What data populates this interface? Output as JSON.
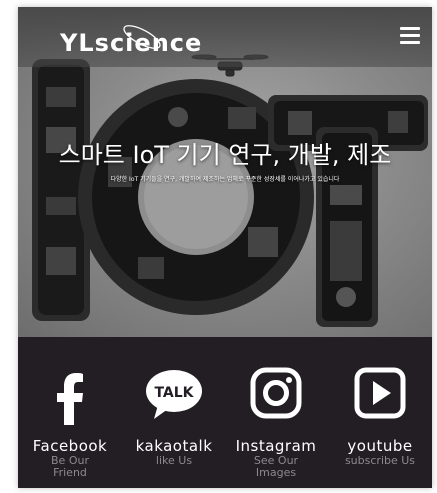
{
  "header": {
    "logo_text": "YLscience",
    "menu_icon": "hamburger-menu-icon"
  },
  "hero": {
    "title": "스마트 IoT 기기 연구, 개발, 제조",
    "subtitle": "다양한 IoT 기기들을 연구, 개발하여 제조하는 업체로 꾸준한 성장세를 이어나가고 있습니다"
  },
  "social": [
    {
      "icon": "facebook-icon",
      "name": "Facebook",
      "sub_line1": "Be Our",
      "sub_line2": "Friend"
    },
    {
      "icon": "kakaotalk-icon",
      "name": "kakaotalk",
      "sub_line1": "like Us",
      "sub_line2": ""
    },
    {
      "icon": "instagram-icon",
      "name": "Instagram",
      "sub_line1": "See Our",
      "sub_line2": "Images"
    },
    {
      "icon": "youtube-icon",
      "name": "youtube",
      "sub_line1": "subscribe Us",
      "sub_line2": ""
    }
  ],
  "colors": {
    "footer_bg": "#231d24",
    "text_white": "#ffffff",
    "sub_text": "#8d8891"
  }
}
